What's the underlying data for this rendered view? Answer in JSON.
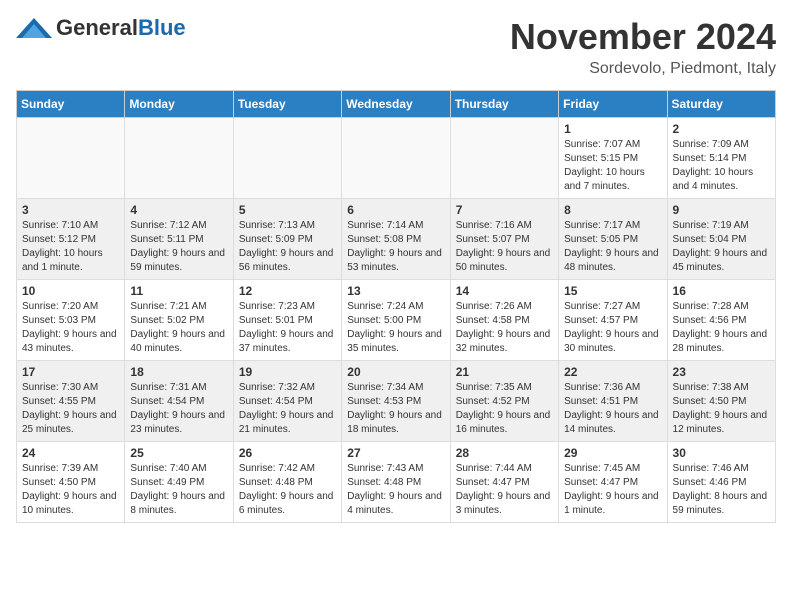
{
  "logo": {
    "general": "General",
    "blue": "Blue"
  },
  "title": "November 2024",
  "location": "Sordevolo, Piedmont, Italy",
  "days_of_week": [
    "Sunday",
    "Monday",
    "Tuesday",
    "Wednesday",
    "Thursday",
    "Friday",
    "Saturday"
  ],
  "weeks": [
    [
      {
        "day": "",
        "info": ""
      },
      {
        "day": "",
        "info": ""
      },
      {
        "day": "",
        "info": ""
      },
      {
        "day": "",
        "info": ""
      },
      {
        "day": "",
        "info": ""
      },
      {
        "day": "1",
        "info": "Sunrise: 7:07 AM\nSunset: 5:15 PM\nDaylight: 10 hours and 7 minutes."
      },
      {
        "day": "2",
        "info": "Sunrise: 7:09 AM\nSunset: 5:14 PM\nDaylight: 10 hours and 4 minutes."
      }
    ],
    [
      {
        "day": "3",
        "info": "Sunrise: 7:10 AM\nSunset: 5:12 PM\nDaylight: 10 hours and 1 minute."
      },
      {
        "day": "4",
        "info": "Sunrise: 7:12 AM\nSunset: 5:11 PM\nDaylight: 9 hours and 59 minutes."
      },
      {
        "day": "5",
        "info": "Sunrise: 7:13 AM\nSunset: 5:09 PM\nDaylight: 9 hours and 56 minutes."
      },
      {
        "day": "6",
        "info": "Sunrise: 7:14 AM\nSunset: 5:08 PM\nDaylight: 9 hours and 53 minutes."
      },
      {
        "day": "7",
        "info": "Sunrise: 7:16 AM\nSunset: 5:07 PM\nDaylight: 9 hours and 50 minutes."
      },
      {
        "day": "8",
        "info": "Sunrise: 7:17 AM\nSunset: 5:05 PM\nDaylight: 9 hours and 48 minutes."
      },
      {
        "day": "9",
        "info": "Sunrise: 7:19 AM\nSunset: 5:04 PM\nDaylight: 9 hours and 45 minutes."
      }
    ],
    [
      {
        "day": "10",
        "info": "Sunrise: 7:20 AM\nSunset: 5:03 PM\nDaylight: 9 hours and 43 minutes."
      },
      {
        "day": "11",
        "info": "Sunrise: 7:21 AM\nSunset: 5:02 PM\nDaylight: 9 hours and 40 minutes."
      },
      {
        "day": "12",
        "info": "Sunrise: 7:23 AM\nSunset: 5:01 PM\nDaylight: 9 hours and 37 minutes."
      },
      {
        "day": "13",
        "info": "Sunrise: 7:24 AM\nSunset: 5:00 PM\nDaylight: 9 hours and 35 minutes."
      },
      {
        "day": "14",
        "info": "Sunrise: 7:26 AM\nSunset: 4:58 PM\nDaylight: 9 hours and 32 minutes."
      },
      {
        "day": "15",
        "info": "Sunrise: 7:27 AM\nSunset: 4:57 PM\nDaylight: 9 hours and 30 minutes."
      },
      {
        "day": "16",
        "info": "Sunrise: 7:28 AM\nSunset: 4:56 PM\nDaylight: 9 hours and 28 minutes."
      }
    ],
    [
      {
        "day": "17",
        "info": "Sunrise: 7:30 AM\nSunset: 4:55 PM\nDaylight: 9 hours and 25 minutes."
      },
      {
        "day": "18",
        "info": "Sunrise: 7:31 AM\nSunset: 4:54 PM\nDaylight: 9 hours and 23 minutes."
      },
      {
        "day": "19",
        "info": "Sunrise: 7:32 AM\nSunset: 4:54 PM\nDaylight: 9 hours and 21 minutes."
      },
      {
        "day": "20",
        "info": "Sunrise: 7:34 AM\nSunset: 4:53 PM\nDaylight: 9 hours and 18 minutes."
      },
      {
        "day": "21",
        "info": "Sunrise: 7:35 AM\nSunset: 4:52 PM\nDaylight: 9 hours and 16 minutes."
      },
      {
        "day": "22",
        "info": "Sunrise: 7:36 AM\nSunset: 4:51 PM\nDaylight: 9 hours and 14 minutes."
      },
      {
        "day": "23",
        "info": "Sunrise: 7:38 AM\nSunset: 4:50 PM\nDaylight: 9 hours and 12 minutes."
      }
    ],
    [
      {
        "day": "24",
        "info": "Sunrise: 7:39 AM\nSunset: 4:50 PM\nDaylight: 9 hours and 10 minutes."
      },
      {
        "day": "25",
        "info": "Sunrise: 7:40 AM\nSunset: 4:49 PM\nDaylight: 9 hours and 8 minutes."
      },
      {
        "day": "26",
        "info": "Sunrise: 7:42 AM\nSunset: 4:48 PM\nDaylight: 9 hours and 6 minutes."
      },
      {
        "day": "27",
        "info": "Sunrise: 7:43 AM\nSunset: 4:48 PM\nDaylight: 9 hours and 4 minutes."
      },
      {
        "day": "28",
        "info": "Sunrise: 7:44 AM\nSunset: 4:47 PM\nDaylight: 9 hours and 3 minutes."
      },
      {
        "day": "29",
        "info": "Sunrise: 7:45 AM\nSunset: 4:47 PM\nDaylight: 9 hours and 1 minute."
      },
      {
        "day": "30",
        "info": "Sunrise: 7:46 AM\nSunset: 4:46 PM\nDaylight: 8 hours and 59 minutes."
      }
    ]
  ]
}
